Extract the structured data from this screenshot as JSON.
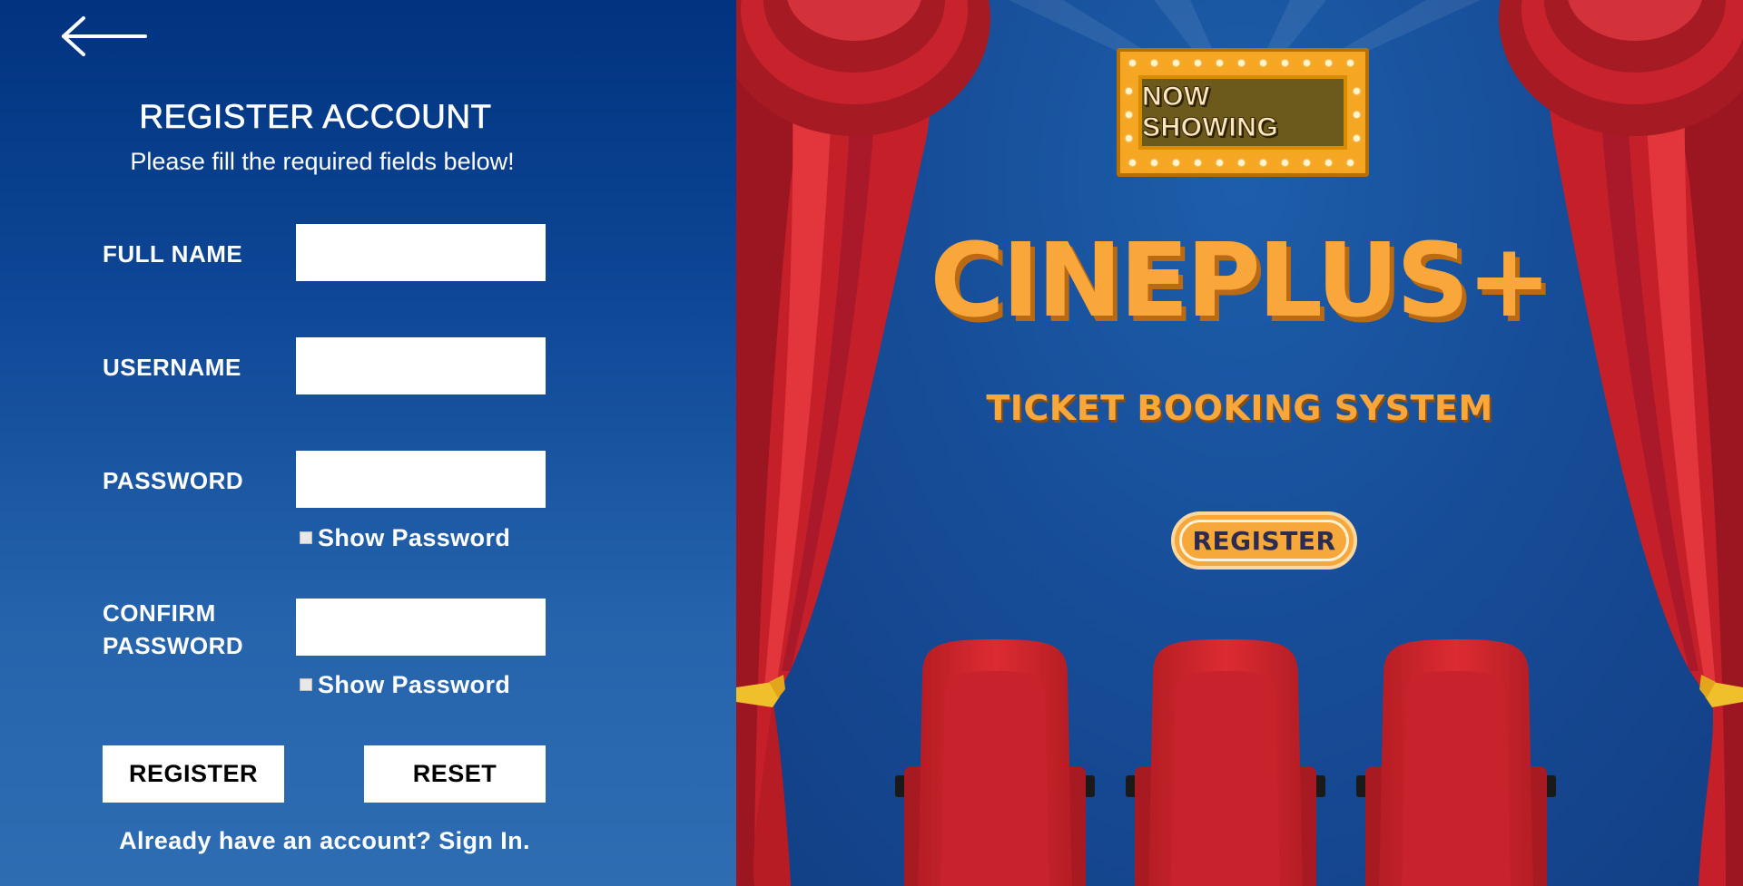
{
  "form": {
    "title": "REGISTER ACCOUNT",
    "subtitle": "Please fill the required fields below!",
    "fields": {
      "full_name": {
        "label": "FULL NAME",
        "value": ""
      },
      "username": {
        "label": "USERNAME",
        "value": ""
      },
      "password": {
        "label": "PASSWORD",
        "value": ""
      },
      "confirm_password": {
        "label_line1": "CONFIRM",
        "label_line2": "PASSWORD",
        "value": ""
      }
    },
    "show_password_label": "Show Password",
    "register_label": "REGISTER",
    "reset_label": "RESET",
    "signin_text": "Already have an account? Sign In."
  },
  "hero": {
    "marquee_text": "NOW SHOWING",
    "brand": "CINEPLUS+",
    "tagline": "TICKET BOOKING SYSTEM",
    "register_label": "REGISTER"
  },
  "icons": {
    "back": "arrow-left-icon",
    "checkbox": "checkbox-icon"
  },
  "colors": {
    "panel_top": "#003380",
    "panel_bottom": "#2e6db2",
    "accent_orange": "#f9a63a",
    "curtain_red": "#c8202a",
    "seat_red": "#d3272e"
  }
}
